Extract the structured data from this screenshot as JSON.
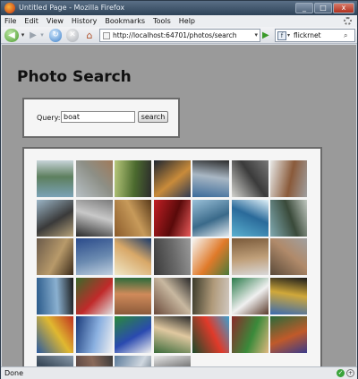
{
  "window": {
    "title": "Untitled Page - Mozilla Firefox",
    "min": "_",
    "max": "□",
    "close": "x"
  },
  "menu": [
    "File",
    "Edit",
    "View",
    "History",
    "Bookmarks",
    "Tools",
    "Help"
  ],
  "nav": {
    "back": "◀",
    "forward": "▶",
    "reload": "↻",
    "stop": "✕",
    "home": "⌂",
    "url": "http://localhost:64701/photos/search",
    "go": "▶",
    "search_engine": "f",
    "search_text": "flickrnet",
    "search_icon": "🔍"
  },
  "page": {
    "title": "Photo Search",
    "query_label": "Query:",
    "query_value": "boat",
    "search_button": "search"
  },
  "photos": [
    [
      "#7aa2b7",
      "#5d7f5e",
      "#c7d4d8"
    ],
    [
      "#b7c0c5",
      "#8d8f86",
      "#a07a5a"
    ],
    [
      "#b7c77a",
      "#4b6a2e",
      "#2c2c2c"
    ],
    [
      "#1c2430",
      "#c98b3a",
      "#2f3a52"
    ],
    [
      "#3a6a9a",
      "#a9b7c4",
      "#2c2c2c"
    ],
    [
      "#d3d3cf",
      "#3b3b3b",
      "#777"
    ],
    [
      "#e8e8e6",
      "#8a5a3a",
      "#a0a0a0"
    ],
    [
      "#9bb5c6",
      "#3a3a3a",
      "#b7a27a"
    ],
    [
      "#2a2a2a",
      "#c8c8c8",
      "#7a7a7a"
    ],
    [
      "#8a5a2a",
      "#c79a5a",
      "#5a3a1a"
    ],
    [
      "#c21f24",
      "#5a0a0a",
      "#e85a5a"
    ],
    [
      "#9ac0d8",
      "#3a6a8a",
      "#e4ebf0"
    ],
    [
      "#5ab0d0",
      "#2a6a9a",
      "#e0f0f8"
    ],
    [
      "#7fa9b0",
      "#3a4a3a",
      "#c0c8c0"
    ],
    [
      "#6a5a4a",
      "#b89a6a",
      "#3a2a1a"
    ],
    [
      "#2a4a8a",
      "#6a8ab0",
      "#c0d0e0"
    ],
    [
      "#f0e8c8",
      "#d8a868",
      "#1a3a6a"
    ],
    [
      "#3a3a3a",
      "#6a6a6a",
      "#9a9a9a"
    ],
    [
      "#f6f6f4",
      "#e07a2a",
      "#4a7a3a"
    ],
    [
      "#7a5a3a",
      "#c0a07a",
      "#d8d8d8"
    ],
    [
      "#5a4a3a",
      "#b08a6a",
      "#a0a0a0"
    ],
    [
      "#2a5a8a",
      "#8ab0d0",
      "#1a1a1a"
    ],
    [
      "#3a6a2a",
      "#c02a2a",
      "#e0e0e0"
    ],
    [
      "#8a5a3a",
      "#d08a5a",
      "#2a6a3a"
    ],
    [
      "#6a4a3a",
      "#c8b8a0",
      "#2a2a2a"
    ],
    [
      "#3a3a2a",
      "#b09a7a",
      "#d0c8c0"
    ],
    [
      "#2a7a4a",
      "#f0f0f0",
      "#5a3a2a"
    ],
    [
      "#3a6ab0",
      "#d0a83a",
      "#1a1a1a"
    ],
    [
      "#2a5aa0",
      "#e0b830",
      "#c03020"
    ],
    [
      "#1a3a7a",
      "#8ab0e0",
      "#f0f0f0"
    ],
    [
      "#2a8a3a",
      "#2a4ab0",
      "#f0f0f0"
    ],
    [
      "#3a6a3a",
      "#e0c8a0",
      "#2a2a2a"
    ],
    [
      "#1a4a2a",
      "#e03a2a",
      "#3aa0d0"
    ],
    [
      "#8a2a2a",
      "#3a8a3a",
      "#e0b880"
    ],
    [
      "#2a6a3a",
      "#c05a2a",
      "#3a3a8a"
    ],
    [
      "#5a6a7a",
      "#3a4a5a",
      "#8a9aaa"
    ],
    [
      "#4a3a3a",
      "#8a6a5a",
      "#3a3a3a"
    ],
    [
      "#5a7a9a",
      "#d0d8e0",
      "#3a4a5a"
    ],
    [
      "#e8e8e8",
      "#5a5a5a",
      "#2a2a2a"
    ]
  ],
  "status": {
    "text": "Done"
  }
}
